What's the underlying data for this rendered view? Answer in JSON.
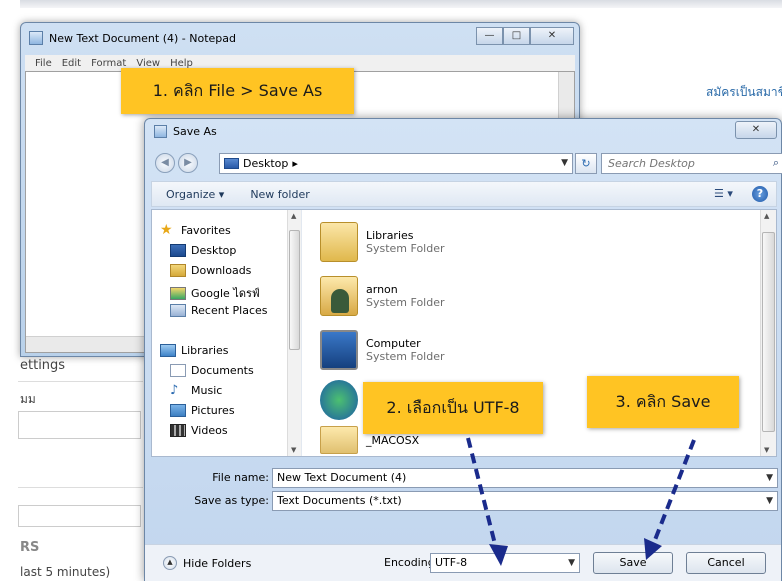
{
  "background_page": {
    "register_link": "สมัครเป็นสมาชิก",
    "settings_label": "ettings",
    "thai_fragment": "มม",
    "section_label": "RS",
    "last_text": "last 5 minutes)"
  },
  "notepad": {
    "title": "New Text Document (4) - Notepad",
    "menu": [
      "File",
      "Edit",
      "Format",
      "View",
      "Help"
    ],
    "controls": {
      "minimize": "—",
      "maximize": "□",
      "close": "✕"
    }
  },
  "save_as": {
    "title": "Save As",
    "close": "✕",
    "nav": {
      "back": "◀",
      "forward": "▶",
      "address_location": "Desktop",
      "address_sep": "▸",
      "search_placeholder": "Search Desktop"
    },
    "toolbar": {
      "organize": "Organize ▾",
      "new_folder": "New folder"
    },
    "nav_pane": {
      "favorites_header": "Favorites",
      "favorites": [
        "Desktop",
        "Downloads",
        "Google ไดรฟ์",
        "Recent Places"
      ],
      "libraries_header": "Libraries",
      "libraries": [
        "Documents",
        "Music",
        "Pictures",
        "Videos"
      ]
    },
    "files": [
      {
        "name": "Libraries",
        "type": "System Folder"
      },
      {
        "name": "arnon",
        "type": "System Folder"
      },
      {
        "name": "Computer",
        "type": "System Folder"
      },
      {
        "name": "",
        "type": ""
      },
      {
        "name": "_MACOSX",
        "type": ""
      }
    ],
    "file_name_label": "File name:",
    "file_name_value": "New Text Document (4)",
    "save_type_label": "Save as type:",
    "save_type_value": "Text Documents (*.txt)",
    "hide_folders": "Hide Folders",
    "encoding_label": "Encoding:",
    "encoding_value": "UTF-8",
    "save_button": "Save",
    "cancel_button": "Cancel"
  },
  "callouts": {
    "step1": "1. คลิก File > Save As",
    "step2": "2. เลือกเป็น UTF-8",
    "step3": "3. คลิก Save"
  },
  "colors": {
    "callout": "#ffc423",
    "arrow": "#1a2b8c"
  }
}
